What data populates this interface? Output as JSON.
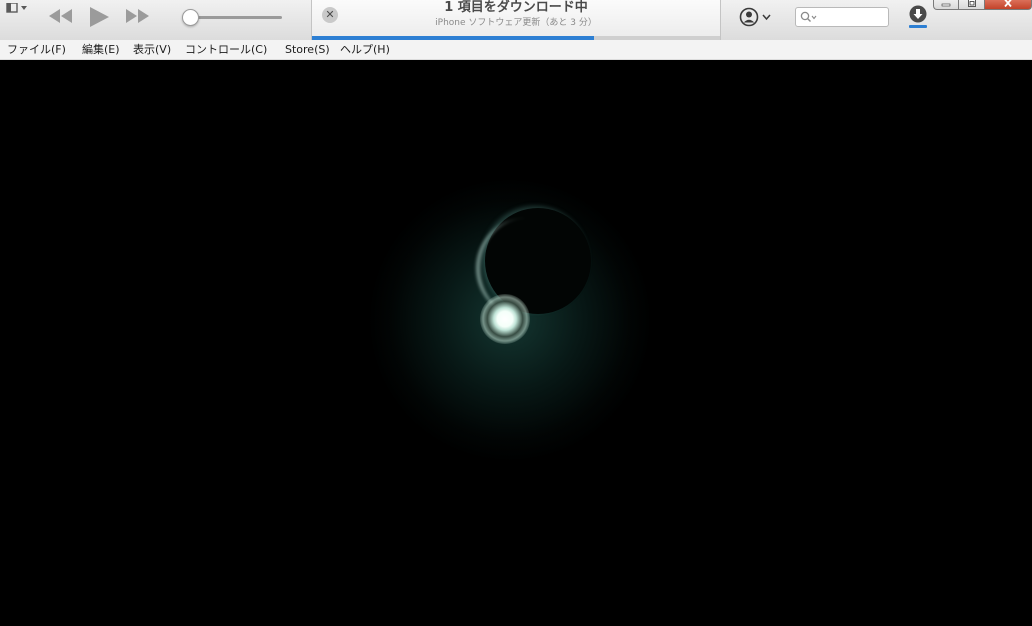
{
  "toolbar": {
    "volume_percent": 0,
    "search": {
      "value": "",
      "placeholder": ""
    },
    "download_indicator_color": "#2d7fd3"
  },
  "now_playing": {
    "title": "1 項目をダウンロード中",
    "subtitle": "iPhone ソフトウェア更新（あと 3 分）",
    "progress_percent": 69,
    "progress_color": "#2d7fd3"
  },
  "icons": {
    "sidebar_toggle": "sidebar-toggle-icon",
    "previous": "rewind-icon",
    "play": "play-icon",
    "next": "fast-forward-icon",
    "cancel": "close-icon",
    "account": "account-icon",
    "search": "search-icon",
    "downloads": "download-icon",
    "minimize": "minimize-icon",
    "restore": "restore-icon",
    "close": "close-window-icon"
  },
  "menu": {
    "items": [
      {
        "label": "ファイル(F)"
      },
      {
        "label": "編集(E)"
      },
      {
        "label": "表示(V)"
      },
      {
        "label": "コントロール(C)"
      },
      {
        "label": "Store(S)"
      },
      {
        "label": "ヘルプ(H)"
      }
    ]
  },
  "video": {
    "background_color": "#000000"
  }
}
